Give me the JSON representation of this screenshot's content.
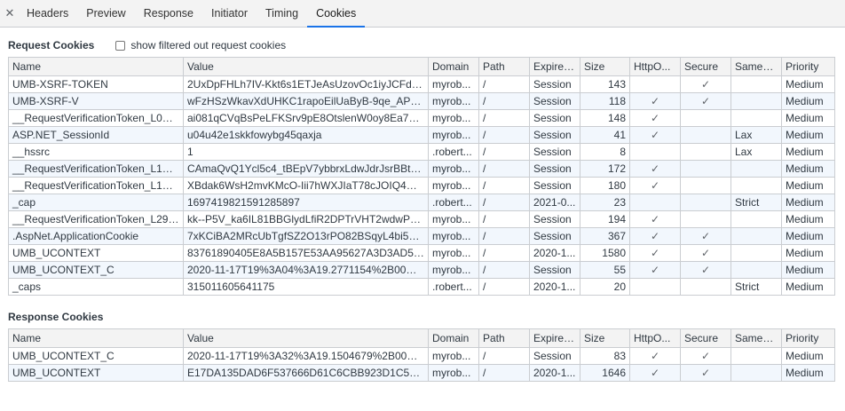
{
  "tabs": [
    "Headers",
    "Preview",
    "Response",
    "Initiator",
    "Timing",
    "Cookies"
  ],
  "active_tab": "Cookies",
  "request": {
    "title": "Request Cookies",
    "filter_label": "show filtered out request cookies",
    "columns": [
      "Name",
      "Value",
      "Domain",
      "Path",
      "Expires...",
      "Size",
      "HttpO...",
      "Secure",
      "SameSi...",
      "Priority"
    ],
    "rows": [
      [
        "UMB-XSRF-TOKEN",
        "2UxDpFHLh7IV-Kkt6s1ETJeAsUzovOc1iyJCFdn32...",
        "myrob...",
        "/",
        "Session",
        "143",
        "",
        "✓",
        "",
        "Medium"
      ],
      [
        "UMB-XSRF-V",
        "wFzHSzWkavXdUHKC1rapoEilUaByB-9qe_APZ9E...",
        "myrob...",
        "/",
        "Session",
        "118",
        "✓",
        "✓",
        "",
        "Medium"
      ],
      [
        "__RequestVerificationToken_L0No...",
        "ai081qCVqBsPeLFKSrv9pE8OtslenW0oy8Ea7uCRx...",
        "myrob...",
        "/",
        "Session",
        "148",
        "✓",
        "",
        "",
        "Medium"
      ],
      [
        "ASP.NET_SessionId",
        "u04u42e1skkfowybg45qaxja",
        "myrob...",
        "/",
        "Session",
        "41",
        "✓",
        "",
        "Lax",
        "Medium"
      ],
      [
        "__hssrc",
        "1",
        ".robert...",
        "/",
        "Session",
        "8",
        "",
        "",
        "Lax",
        "Medium"
      ],
      [
        "__RequestVerificationToken_L1N1...",
        "CAmaQvQ1Ycl5c4_tBEpV7ybbrxLdwJdrJsrBBt8P3...",
        "myrob...",
        "/",
        "Session",
        "172",
        "✓",
        "",
        "",
        "Medium"
      ],
      [
        "__RequestVerificationToken_L1Vu...",
        "XBdak6WsH2mvKMcO-Iii7hWXJIaT78cJOIQ4RO...",
        "myrob...",
        "/",
        "Session",
        "180",
        "✓",
        "",
        "",
        "Medium"
      ],
      [
        "_cap",
        "1697419821591285897",
        ".robert...",
        "/",
        "2021-0...",
        "23",
        "",
        "",
        "Strict",
        "Medium"
      ],
      [
        "__RequestVerificationToken_L29u...",
        "kk--P5V_ka6IL81BBGlydLfiR2DPTrVHT2wdwP3ftj...",
        "myrob...",
        "/",
        "Session",
        "194",
        "✓",
        "",
        "",
        "Medium"
      ],
      [
        ".AspNet.ApplicationCookie",
        "7xKCiBA2MRcUbTgfSZ2O13rPO82BSqyL4bi55I2iJ...",
        "myrob...",
        "/",
        "Session",
        "367",
        "✓",
        "✓",
        "",
        "Medium"
      ],
      [
        "UMB_UCONTEXT",
        "83761890405E8A5B157E53AA95627A3D3AD513...",
        "myrob...",
        "/",
        "2020-1...",
        "1580",
        "✓",
        "✓",
        "",
        "Medium"
      ],
      [
        "UMB_UCONTEXT_C",
        "2020-11-17T19%3A04%3A19.2771154%2B00%3...",
        "myrob...",
        "/",
        "Session",
        "55",
        "✓",
        "✓",
        "",
        "Medium"
      ],
      [
        "_caps",
        "315011605641175",
        ".robert...",
        "/",
        "2020-1...",
        "20",
        "",
        "",
        "Strict",
        "Medium"
      ]
    ]
  },
  "response": {
    "title": "Response Cookies",
    "columns": [
      "Name",
      "Value",
      "Domain",
      "Path",
      "Expires...",
      "Size",
      "HttpO...",
      "Secure",
      "SameSi...",
      "Priority"
    ],
    "rows": [
      [
        "UMB_UCONTEXT_C",
        "2020-11-17T19%3A32%3A19.1504679%2B00%3...",
        "myrob...",
        "/",
        "Session",
        "83",
        "✓",
        "✓",
        "",
        "Medium"
      ],
      [
        "UMB_UCONTEXT",
        "E17DA135DAD6F537666D61C6CBB923D1C58AE...",
        "myrob...",
        "/",
        "2020-1...",
        "1646",
        "✓",
        "✓",
        "",
        "Medium"
      ]
    ]
  },
  "icons": {
    "close": "close-icon",
    "checkbox": "checkbox-unchecked"
  },
  "colors": {
    "accent": "#1a73e8",
    "zebra": "#f2f7fd",
    "border": "#cacdd1"
  }
}
